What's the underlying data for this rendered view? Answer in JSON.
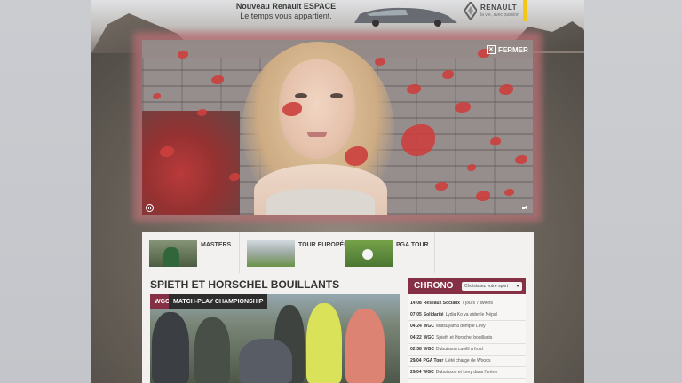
{
  "ad": {
    "line1": "Nouveau Renault ESPACE",
    "line2": "Le temps vous appartient.",
    "brand": "RENAULT",
    "tagline": "la vie, avec passion"
  },
  "video": {
    "close_label": "FERMER"
  },
  "categories": [
    {
      "label": "MASTERS"
    },
    {
      "label": "TOUR EUROPÉEN"
    },
    {
      "label": "PGA TOUR"
    }
  ],
  "article": {
    "headline": "SPIETH ET HORSCHEL BOUILLANTS",
    "tag_wgc": "WGC",
    "tag_event": "MATCH-PLAY CHAMPIONSHIP"
  },
  "chrono": {
    "title": "CHRONO",
    "select_label": "Choisissez votre sport",
    "items": [
      {
        "time": "14:08",
        "cat": "Réseaux Sociaux",
        "text": "7 jours 7 tweets"
      },
      {
        "time": "07:05",
        "cat": "Solidarité",
        "text": "Lydia Ko va aider le Népal"
      },
      {
        "time": "04:24",
        "cat": "WGC",
        "text": "Matsuyama domple Levy"
      },
      {
        "time": "04:22",
        "cat": "WGC",
        "text": "Spieth et Horschel bouillants"
      },
      {
        "time": "02:38",
        "cat": "WGC",
        "text": "Dubuisson cueilli à froid"
      },
      {
        "time": "29/04",
        "cat": "PGA Tour",
        "text": "L'été charge de Woods"
      },
      {
        "time": "29/04",
        "cat": "WGC",
        "text": "Dubuisson et Levy dans l'arène"
      }
    ]
  }
}
